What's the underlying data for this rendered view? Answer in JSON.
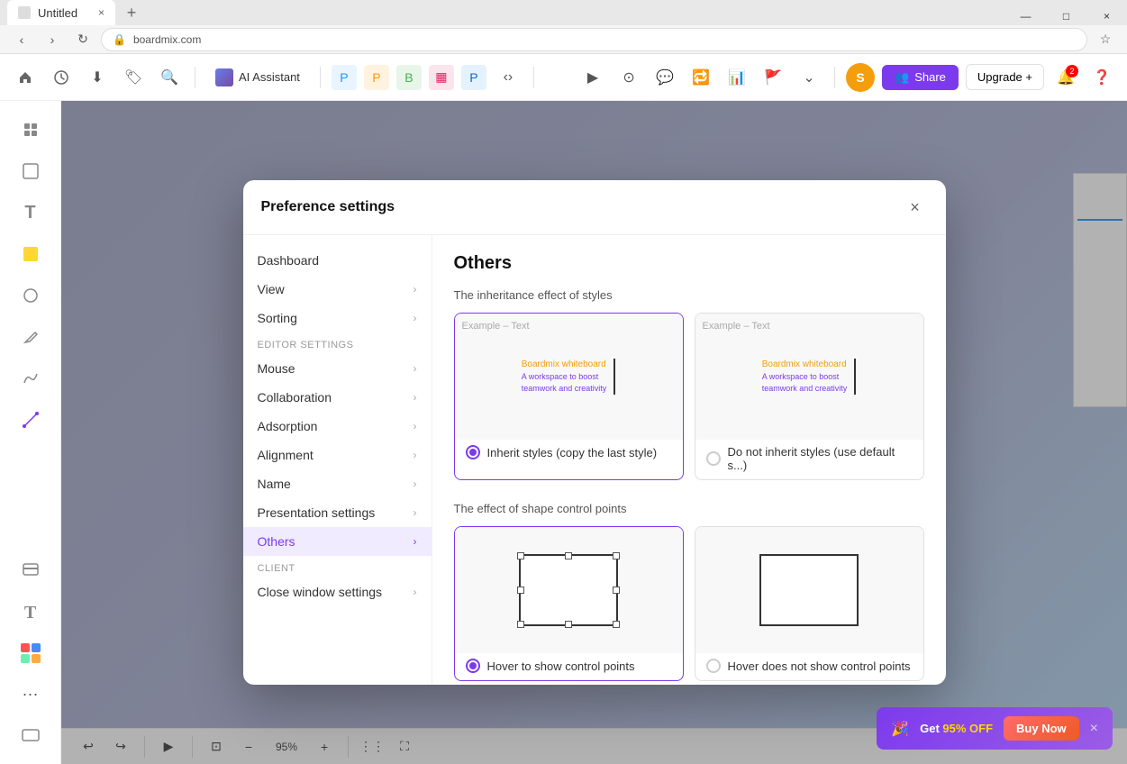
{
  "browser": {
    "tab_title": "Untitled",
    "tab_close": "×",
    "tab_new": "+",
    "window_minimize": "—",
    "window_maximize": "□",
    "window_close": "×"
  },
  "toolbar": {
    "ai_assistant_label": "AI Assistant",
    "share_label": "Share",
    "upgrade_label": "Upgrade +",
    "user_initial": "S",
    "notification_count": "2"
  },
  "dialog": {
    "title": "Preference settings",
    "close_label": "×",
    "nav": {
      "top_items": [
        {
          "id": "dashboard",
          "label": "Dashboard"
        },
        {
          "id": "view",
          "label": "View"
        },
        {
          "id": "sorting",
          "label": "Sorting"
        }
      ],
      "editor_section": "Editor settings",
      "editor_items": [
        {
          "id": "mouse",
          "label": "Mouse"
        },
        {
          "id": "collaboration",
          "label": "Collaboration"
        },
        {
          "id": "adsorption",
          "label": "Adsorption"
        },
        {
          "id": "alignment",
          "label": "Alignment"
        },
        {
          "id": "name",
          "label": "Name"
        },
        {
          "id": "presentation",
          "label": "Presentation settings"
        },
        {
          "id": "others",
          "label": "Others",
          "active": true
        }
      ],
      "client_section": "Client",
      "client_items": [
        {
          "id": "close-window",
          "label": "Close window settings"
        }
      ]
    },
    "content": {
      "section_title": "Others",
      "inheritance_title": "The inheritance effect of styles",
      "inherit_option": {
        "label": "Inherit styles (copy the last style)",
        "preview_label": "Example – Text",
        "text_line1": "Boardmix whiteboard",
        "text_line2": "A workspace to boost",
        "text_line3": "teamwork and creativity",
        "selected": true
      },
      "no_inherit_option": {
        "label": "Do not inherit styles (use default s...)",
        "preview_label": "Example – Text",
        "text_line1": "Boardmix whiteboard",
        "text_line2": "A workspace to boost",
        "text_line3": "teamwork and creativity",
        "selected": false
      },
      "control_points_title": "The effect of shape control points",
      "hover_show_option": {
        "label": "Hover to show control points",
        "selected": true
      },
      "hover_hide_option": {
        "label": "Hover does not show control points",
        "selected": false
      }
    }
  },
  "promo": {
    "text_prefix": "Get",
    "discount": "95% OFF",
    "buy_label": "Buy Now",
    "close": "×"
  },
  "bottom_bar": {
    "zoom_level": "95%"
  }
}
